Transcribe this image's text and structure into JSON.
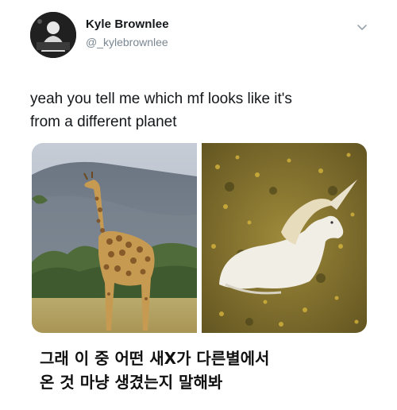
{
  "tweet": {
    "author": {
      "display_name": "Kyle Brownlee",
      "handle": "@_kylebrownlee"
    },
    "text_lines": [
      "yeah you tell me which mf looks like it's",
      "from a different planet"
    ],
    "media": [
      {
        "subject": "giraffe"
      },
      {
        "subject": "unicorn"
      }
    ],
    "menu_icon": "chevron-down-icon"
  },
  "caption": {
    "lines": [
      "그래 이 중 어떤 새X가 다른별에서",
      "온 것 마냥 생겼는지 말해봐"
    ]
  }
}
